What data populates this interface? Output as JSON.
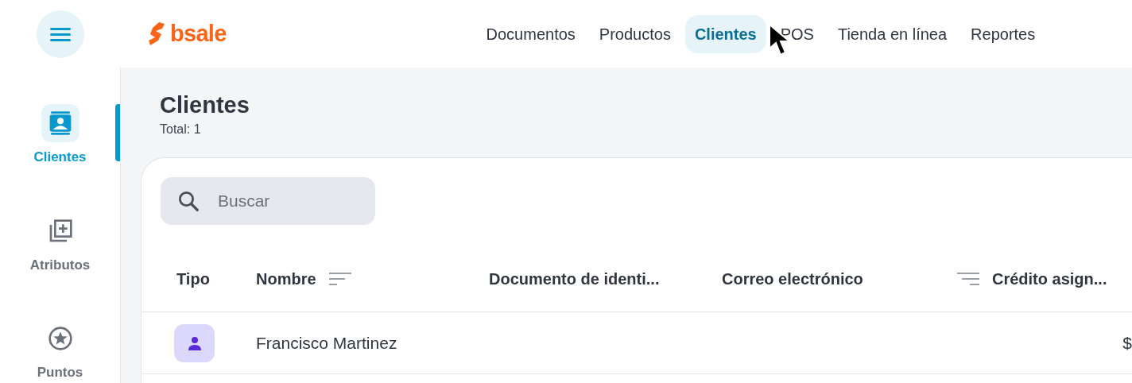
{
  "logo": {
    "text": "bsale"
  },
  "nav": [
    {
      "label": "Documentos",
      "selected": false
    },
    {
      "label": "Productos",
      "selected": false
    },
    {
      "label": "Clientes",
      "selected": true
    },
    {
      "label": "POS",
      "selected": false
    },
    {
      "label": "Tienda en línea",
      "selected": false
    },
    {
      "label": "Reportes",
      "selected": false
    }
  ],
  "sidebar": {
    "items": [
      {
        "label": "Clientes",
        "selected": true
      },
      {
        "label": "Atributos",
        "selected": false
      },
      {
        "label": "Puntos",
        "selected": false
      }
    ]
  },
  "page": {
    "title": "Clientes",
    "total": "Total: 1"
  },
  "search": {
    "placeholder": "Buscar"
  },
  "table": {
    "columns": [
      {
        "label": "Tipo",
        "kind": "plain"
      },
      {
        "label": "Nombre",
        "kind": "sortable"
      },
      {
        "label": "Documento de identi...",
        "kind": "plain"
      },
      {
        "label": "Correo electrónico",
        "kind": "plain"
      },
      {
        "label": "Crédito asign...",
        "kind": "filterable"
      }
    ],
    "rows": [
      {
        "kind": "person",
        "name": "Francisco Martinez",
        "credit": "$"
      }
    ]
  }
}
